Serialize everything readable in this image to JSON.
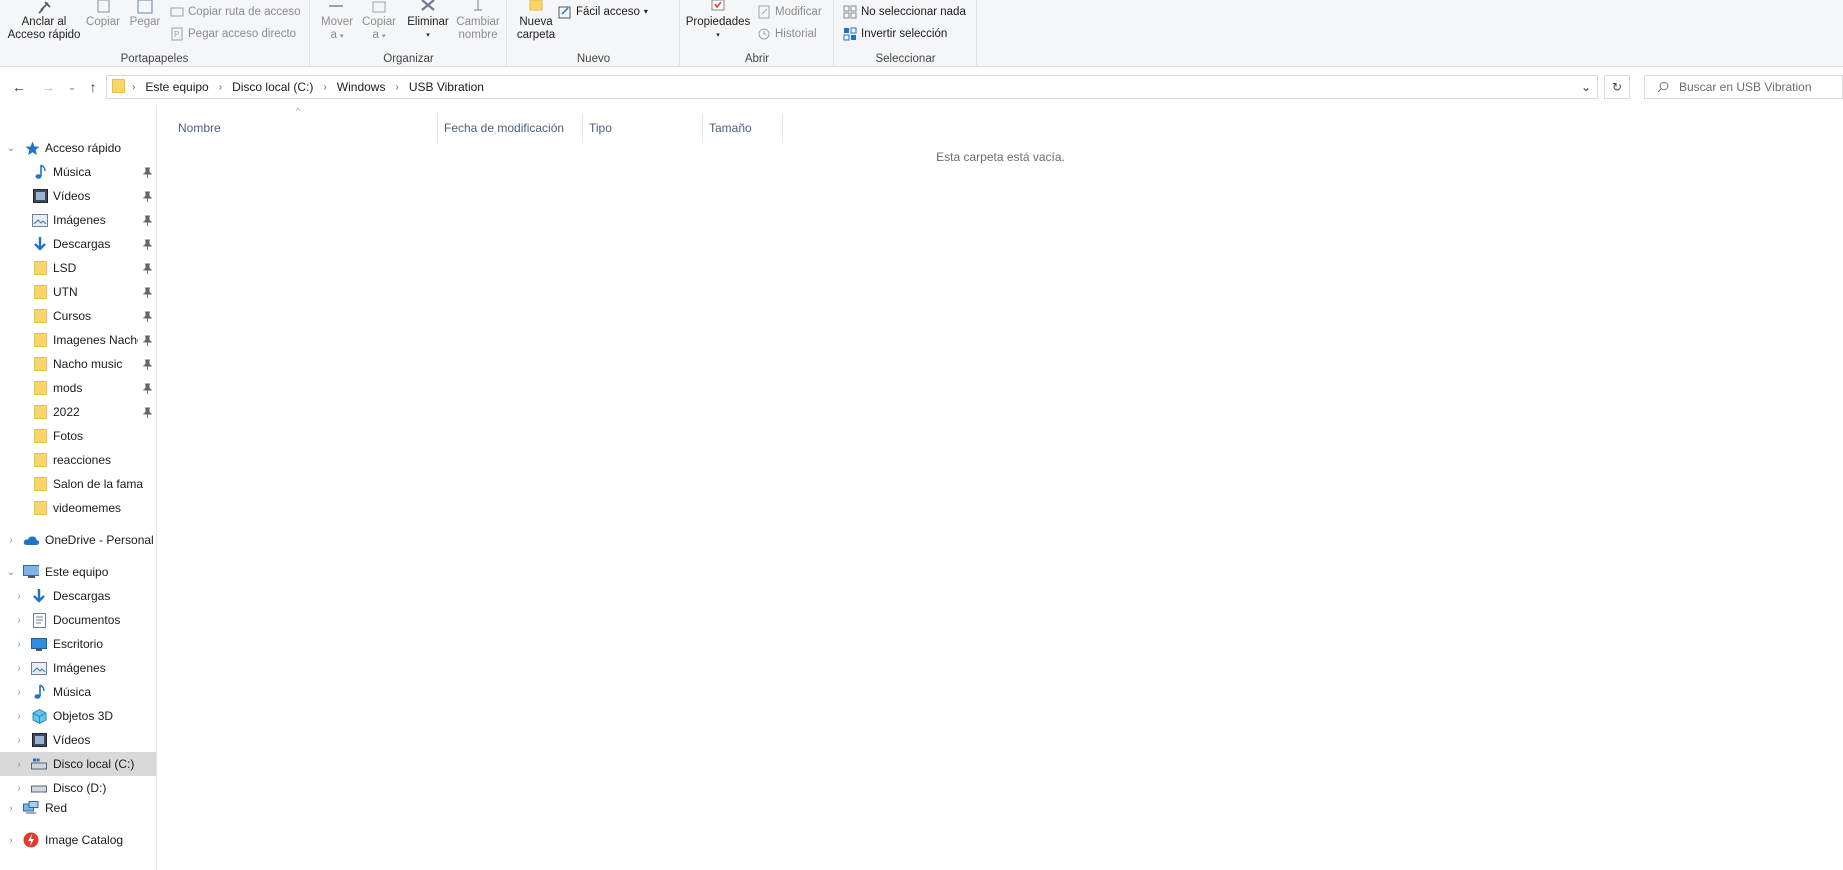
{
  "ribbon": {
    "portapapeles": {
      "label": "Portapapeles",
      "anclar": "Anclar al\nAcceso rápido",
      "anclar_l1": "Anclar al",
      "anclar_l2": "Acceso rápido",
      "copiar": "Copiar",
      "pegar": "Pegar",
      "copiar_ruta": "Copiar ruta de acceso",
      "pegar_acceso": "Pegar acceso directo"
    },
    "organizar": {
      "label": "Organizar",
      "mover_l1": "Mover",
      "mover_l2": "a",
      "copiar_l1": "Copiar",
      "copiar_l2": "a",
      "eliminar": "Eliminar",
      "cambiar_l1": "Cambiar",
      "cambiar_l2": "nombre"
    },
    "nuevo": {
      "label": "Nuevo",
      "nueva_l1": "Nueva",
      "nueva_l2": "carpeta",
      "facil": "Fácil acceso"
    },
    "abrir": {
      "label": "Abrir",
      "propiedades": "Propiedades",
      "modificar": "Modificar",
      "historial": "Historial"
    },
    "seleccionar": {
      "label": "Seleccionar",
      "no_sel": "No seleccionar nada",
      "invertir": "Invertir selección"
    }
  },
  "address": {
    "crumbs": [
      "Este equipo",
      "Disco local (C:)",
      "Windows",
      "USB Vibration"
    ]
  },
  "search": {
    "placeholder": "Buscar en USB Vibration"
  },
  "nav": {
    "quick_access": "Acceso rápido",
    "quick_items": [
      "Música",
      "Vídeos",
      "Imágenes",
      "Descargas",
      "LSD",
      "UTN",
      "Cursos",
      "Imagenes Nacho",
      "Nacho music",
      "mods",
      "2022",
      "Fotos",
      "reacciones",
      "Salon de la fama",
      "videomemes"
    ],
    "onedrive": "OneDrive - Personal",
    "this_pc": "Este equipo",
    "pc_items": [
      "Descargas",
      "Documentos",
      "Escritorio",
      "Imágenes",
      "Música",
      "Objetos 3D",
      "Vídeos",
      "Disco local (C:)",
      "Disco (D:)"
    ],
    "red": "Red",
    "image_catalog": "Image Catalog"
  },
  "columns": [
    "Nombre",
    "Fecha de modificación",
    "Tipo",
    "Tamaño"
  ],
  "empty_message": "Esta carpeta está vacía.",
  "colors": {
    "folder": "#f9d66c",
    "selected": "#d9d9d9",
    "accent": "#1e73c8",
    "header_text": "#4c607a"
  }
}
